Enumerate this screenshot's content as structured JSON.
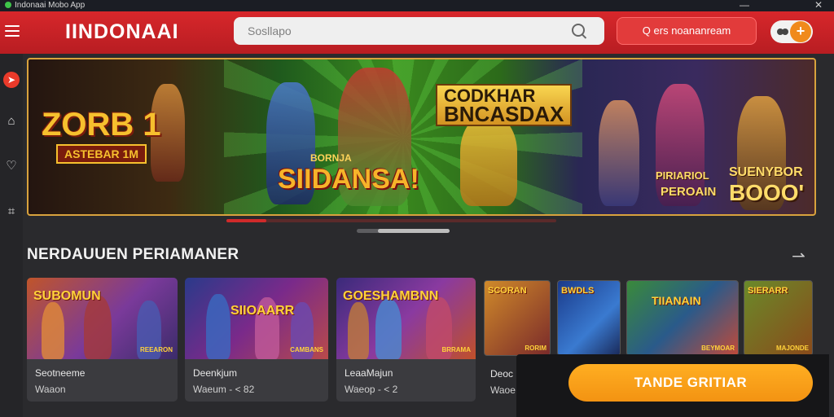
{
  "window": {
    "title": "Indonaai Mobo App"
  },
  "header": {
    "logo": "IINDONAAI",
    "search_placeholder": "Sosllapo",
    "action_button": "Q ers noananream",
    "toggle_knob": "+"
  },
  "banner": {
    "left_title": "ZORB 1",
    "left_sub": "ASTEBAR 1M",
    "mid_small": "BORNJA",
    "mid_title": "SIIDANSA!",
    "right_top_1": "CODKHAR",
    "right_top_2": "BNCASDAX",
    "right_promo_1": "PIRIARIOL",
    "right_promo_2": "PEROAIN",
    "right_promo_3": "SUENYBOR",
    "right_promo_4": "BOOO'",
    "progress": 0.12
  },
  "section": {
    "title": "NERDAUUEN PERIAMANER",
    "next_label": "⇀"
  },
  "cards": [
    {
      "title": "SUBOMUN",
      "sub": "REEARON",
      "name": "Seotneeme",
      "meta": "Waaon"
    },
    {
      "title": "SIIOAARR",
      "sub": "CAMBANS",
      "name": "Deenkjum",
      "meta": "Waeum - < 82"
    },
    {
      "title": "GOESHAMBNN",
      "sub": "BRRAMA",
      "name": "LeaaMajun",
      "meta": "Waeop - < 2"
    }
  ],
  "mini_cards": [
    {
      "title": "SCORAN",
      "sub": "RORIM"
    },
    {
      "title": "BWDLS",
      "sub": ""
    },
    {
      "title": "TIIANAIN",
      "sub": "BEYMOAR"
    },
    {
      "title": "SIERARR",
      "sub": "MAJONDE"
    }
  ],
  "mini_meta": {
    "name": "Deoc",
    "meta": "Waoe"
  },
  "cta": {
    "label": "TANDE GRITIAR"
  },
  "colors": {
    "header_red": "#c8242a",
    "accent_orange": "#f5a01a",
    "background": "#2a2a2d"
  }
}
